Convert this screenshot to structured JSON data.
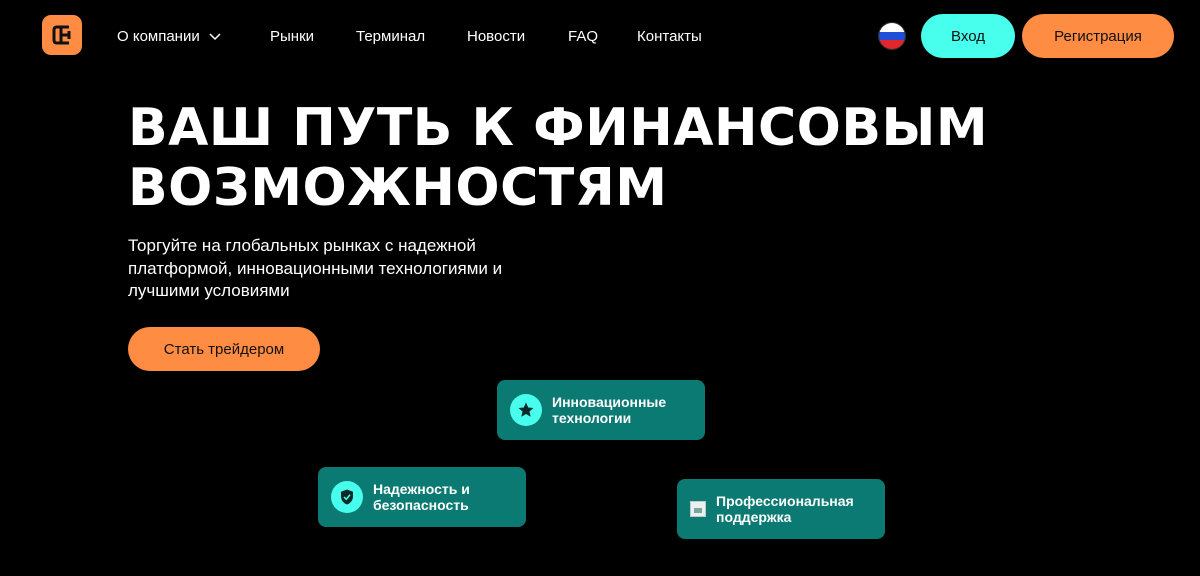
{
  "colors": {
    "background": "#000000",
    "accent_orange": "#ff8c42",
    "accent_cyan": "#48ffee",
    "feature_card": "#0b7a72"
  },
  "header": {
    "logo_icon": "brand-logo-icon",
    "nav": [
      {
        "label": "О компании",
        "has_dropdown": true
      },
      {
        "label": "Рынки"
      },
      {
        "label": "Терминал"
      },
      {
        "label": "Новости"
      },
      {
        "label": "FAQ"
      },
      {
        "label": "Контакты"
      }
    ],
    "language_flag": "ru-flag-icon",
    "login_label": "Вход",
    "register_label": "Регистрация"
  },
  "hero": {
    "title_line1": "ВАШ ПУТЬ К ФИНАНСОВЫМ",
    "title_line2": "ВОЗМОЖНОСТЯМ",
    "subtitle": "Торгуйте на глобальных рынках с надежной платформой, инновационными технологиями и лучшими условиями",
    "cta_label": "Стать трейдером"
  },
  "features": [
    {
      "label": "Инновационные\nтехнологии",
      "icon": "star-icon"
    },
    {
      "label": "Надежность и\nбезопасность",
      "icon": "shield-check-icon"
    },
    {
      "label": "Профессиональная\nподдержка",
      "icon": "broken-image-icon"
    }
  ]
}
